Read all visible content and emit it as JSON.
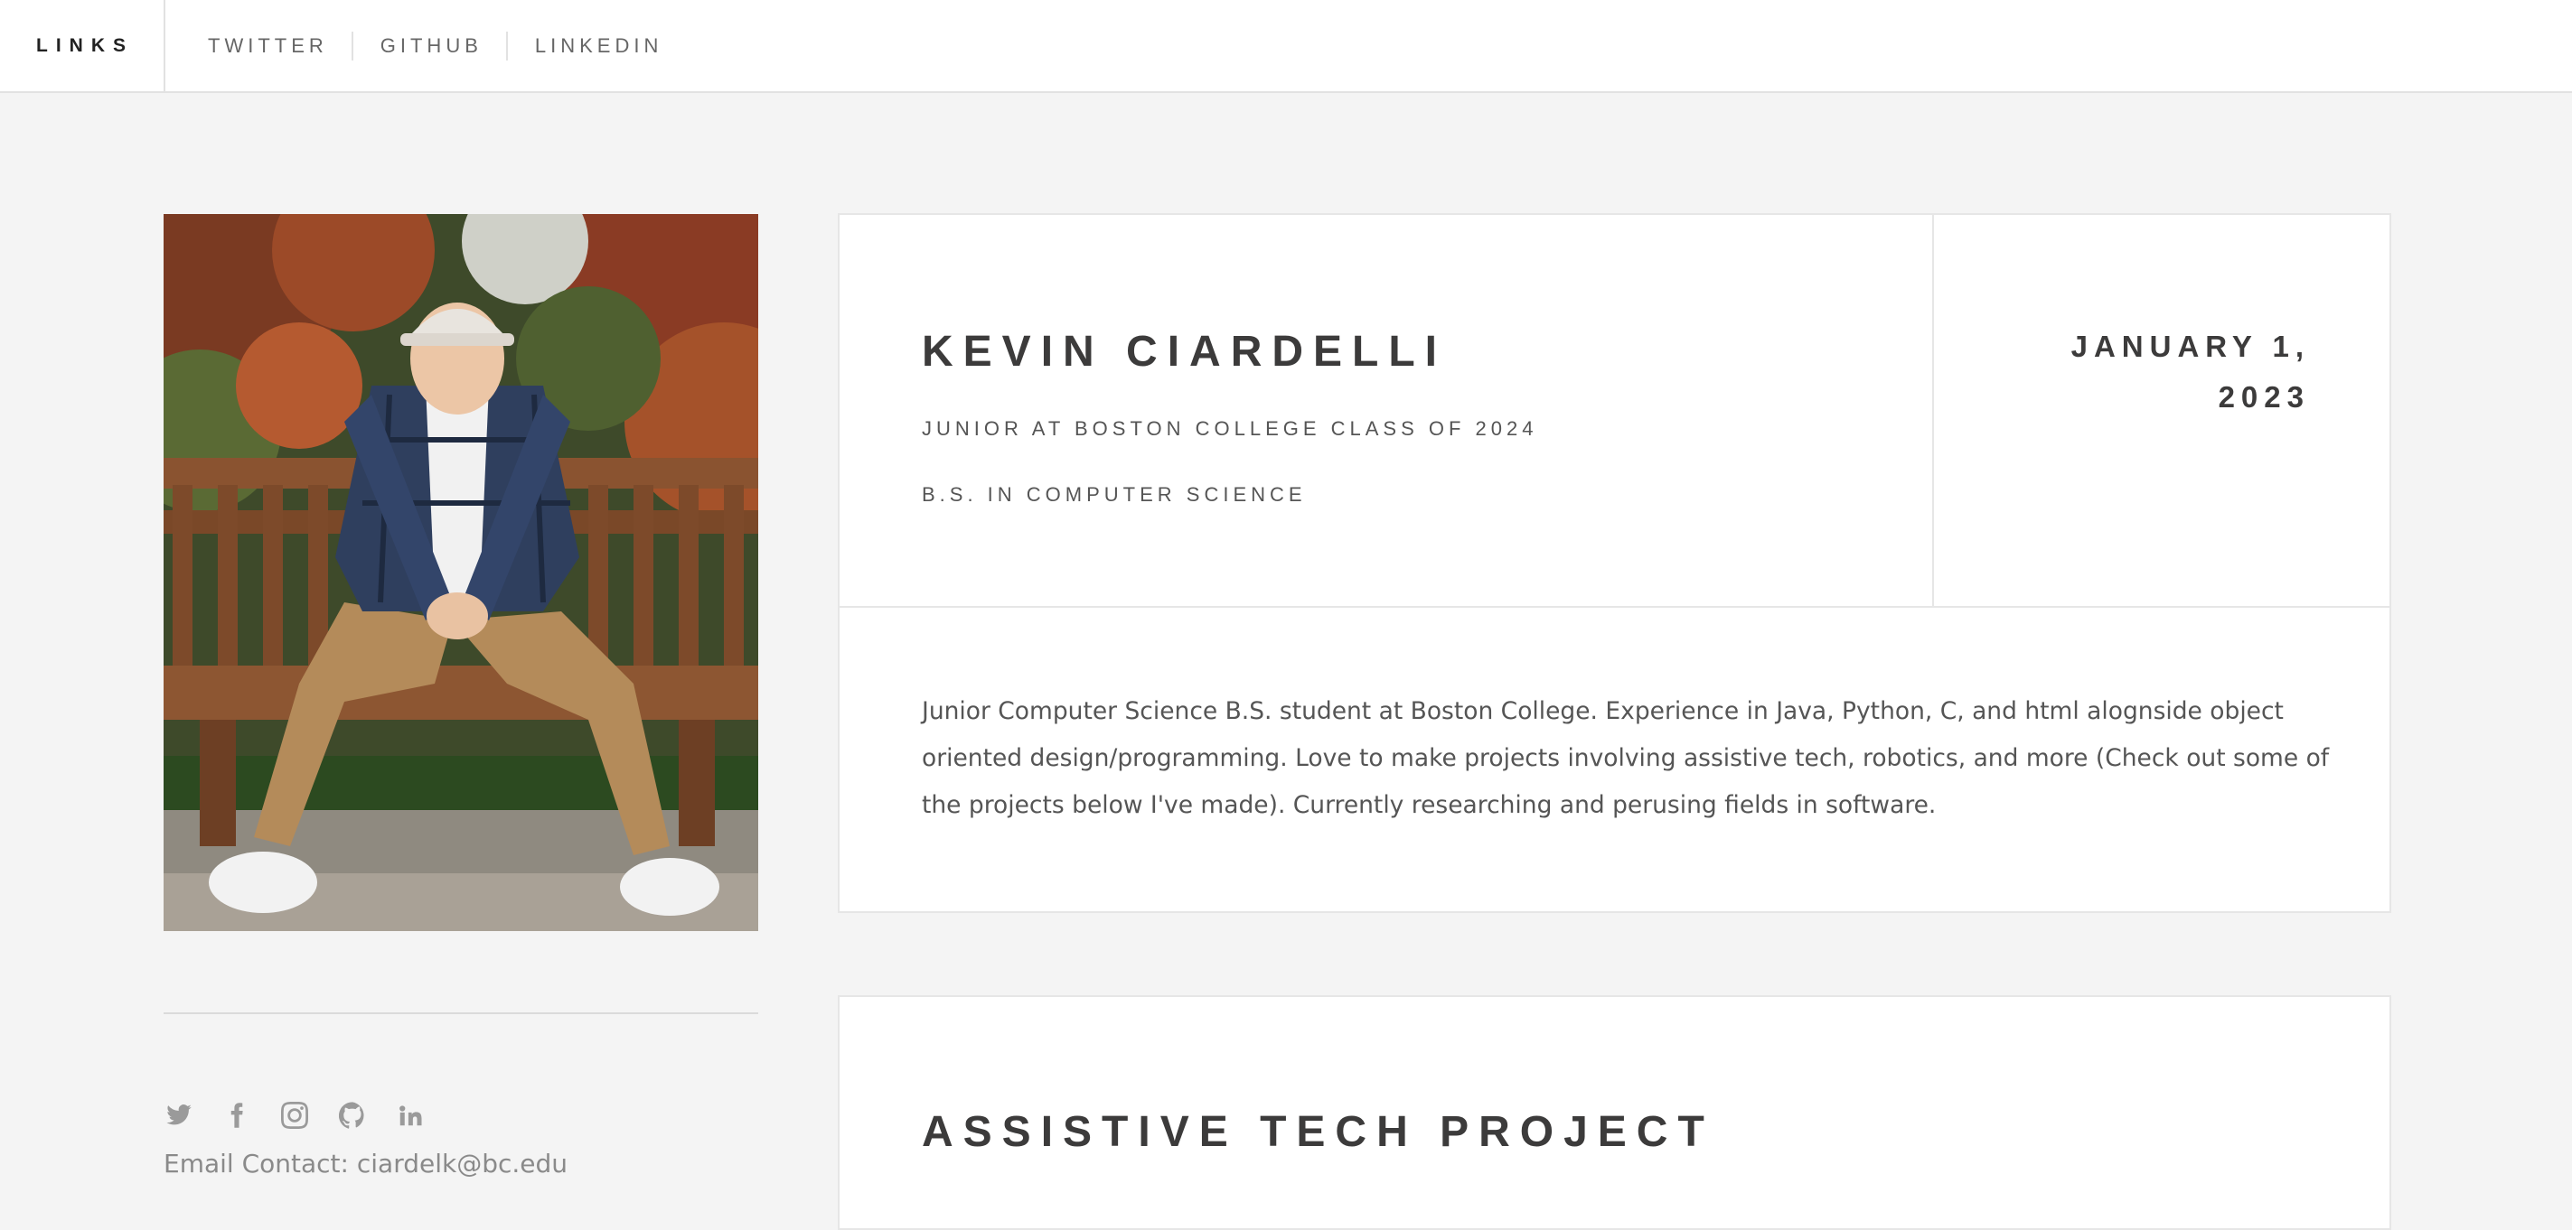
{
  "header": {
    "brand": "LINKS",
    "nav": [
      "TWITTER",
      "GITHUB",
      "LINKEDIN"
    ]
  },
  "profile": {
    "photo_alt": "",
    "social_icons": [
      "twitter-icon",
      "facebook-icon",
      "instagram-icon",
      "github-icon",
      "linkedin-icon"
    ],
    "email_label": "Email Contact: ciardelk@bc.edu"
  },
  "intro_card": {
    "name": "KEVIN CIARDELLI",
    "subtitle_1": "JUNIOR AT BOSTON COLLEGE CLASS OF 2024",
    "subtitle_2": "B.S. IN COMPUTER SCIENCE",
    "date": "JANUARY 1, 2023",
    "bio": "Junior Computer Science B.S. student at Boston College. Experience in Java, Python, C, and html alognside object oriented design/programming. Love to make projects involving assistive tech, robotics, and more (Check out some of the projects below I've made). Currently researching and perusing fields in software."
  },
  "project_card": {
    "title": "ASSISTIVE TECH PROJECT"
  },
  "colors": {
    "background": "#f4f4f4",
    "card": "#ffffff",
    "heading": "#3c3b3b"
  }
}
